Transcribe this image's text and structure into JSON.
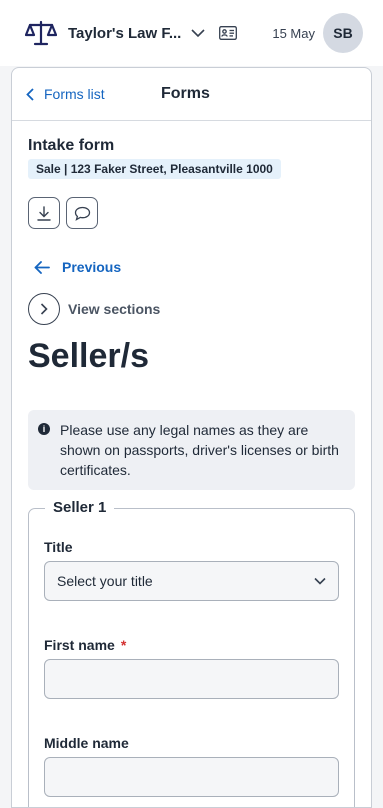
{
  "header": {
    "firm_name": "Taylor's Law F...",
    "date": "15 May",
    "avatar_initials": "SB"
  },
  "panel": {
    "back_label": "Forms list",
    "title": "Forms"
  },
  "form": {
    "name": "Intake form",
    "matter": "Sale | 123 Faker Street, Pleasantville 1000",
    "previous_label": "Previous",
    "view_sections_label": "View sections",
    "heading": "Seller/s",
    "info_text": "Please use any legal names as they are shown on passports, driver's licenses or birth certificates."
  },
  "seller": {
    "legend": "Seller 1",
    "title_label": "Title",
    "title_value": "Select your title",
    "first_name_label": "First name",
    "required_mark": "*",
    "first_name_value": "",
    "middle_name_label": "Middle name",
    "middle_name_value": ""
  },
  "colors": {
    "link": "#1565c0",
    "required": "#d32f2f",
    "badge_bg": "#e5f1fb",
    "info_bg": "#eef0f4"
  }
}
